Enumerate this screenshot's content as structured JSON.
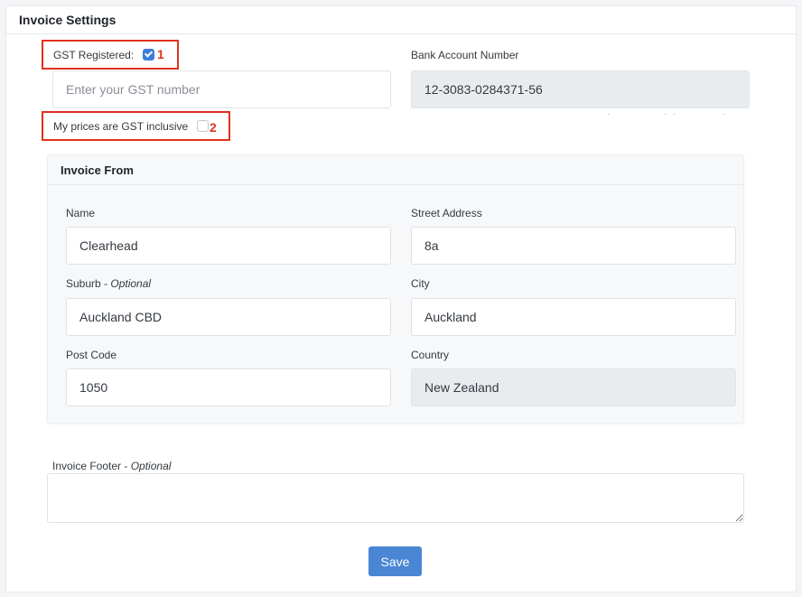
{
  "header": {
    "title": "Invoice Settings"
  },
  "gst": {
    "registered_label": "GST Registered:",
    "registered_checked": true,
    "gst_number_placeholder": "Enter your GST number",
    "gst_number_value": "",
    "inclusive_label": "My prices are GST inclusive",
    "inclusive_checked": false
  },
  "bank": {
    "label": "Bank Account Number",
    "value": "12-3083-0284371-56"
  },
  "annotations": [
    "1",
    "2"
  ],
  "invoice_from": {
    "title": "Invoice From",
    "name_label": "Name",
    "name_value": "Clearhead",
    "street_label": "Street Address",
    "street_value": "8a",
    "suburb_label": "Suburb",
    "suburb_optional": "Optional",
    "suburb_value": "Auckland CBD",
    "city_label": "City",
    "city_value": "Auckland",
    "postcode_label": "Post Code",
    "postcode_value": "1050",
    "country_label": "Country",
    "country_value": "New Zealand"
  },
  "footer": {
    "label": "Invoice Footer",
    "optional": "Optional",
    "value": ""
  },
  "actions": {
    "save_label": "Save"
  },
  "colors": {
    "accent": "#4a86d4",
    "annotation": "#e0321d",
    "readonly_bg": "#e9ecef"
  }
}
